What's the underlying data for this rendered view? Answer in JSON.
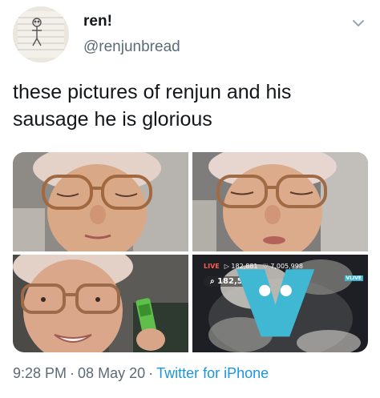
{
  "tweet": {
    "display_name": "ren!",
    "handle": "@renjunbread",
    "text": "these pictures of renjun and his sausage he is glorious",
    "menu_icon": "chevron-down-icon",
    "avatar_icon": "doodle-avatar"
  },
  "media": {
    "photos": [
      {
        "name": "photo-1",
        "subject": "face with round glasses, looking down"
      },
      {
        "name": "photo-2",
        "subject": "face with round glasses, eyes closed"
      },
      {
        "name": "photo-3",
        "subject": "smiling with a green snack stick"
      },
      {
        "name": "photo-4",
        "subject": "livestream screenshot, blurred"
      }
    ],
    "live_overlay": {
      "live_label": "LIVE",
      "views": "▷ 182,881",
      "hearts": "♡ 7,005,998",
      "search_count": "⌕ 182,598",
      "vlive_label": "VLIVE"
    }
  },
  "meta": {
    "time": "9:28 PM",
    "date": "08 May 20",
    "separator": "·",
    "source": "Twitter for iPhone"
  },
  "colors": {
    "text": "#14171a",
    "secondary": "#5b6b78",
    "link": "#1b95e0"
  }
}
